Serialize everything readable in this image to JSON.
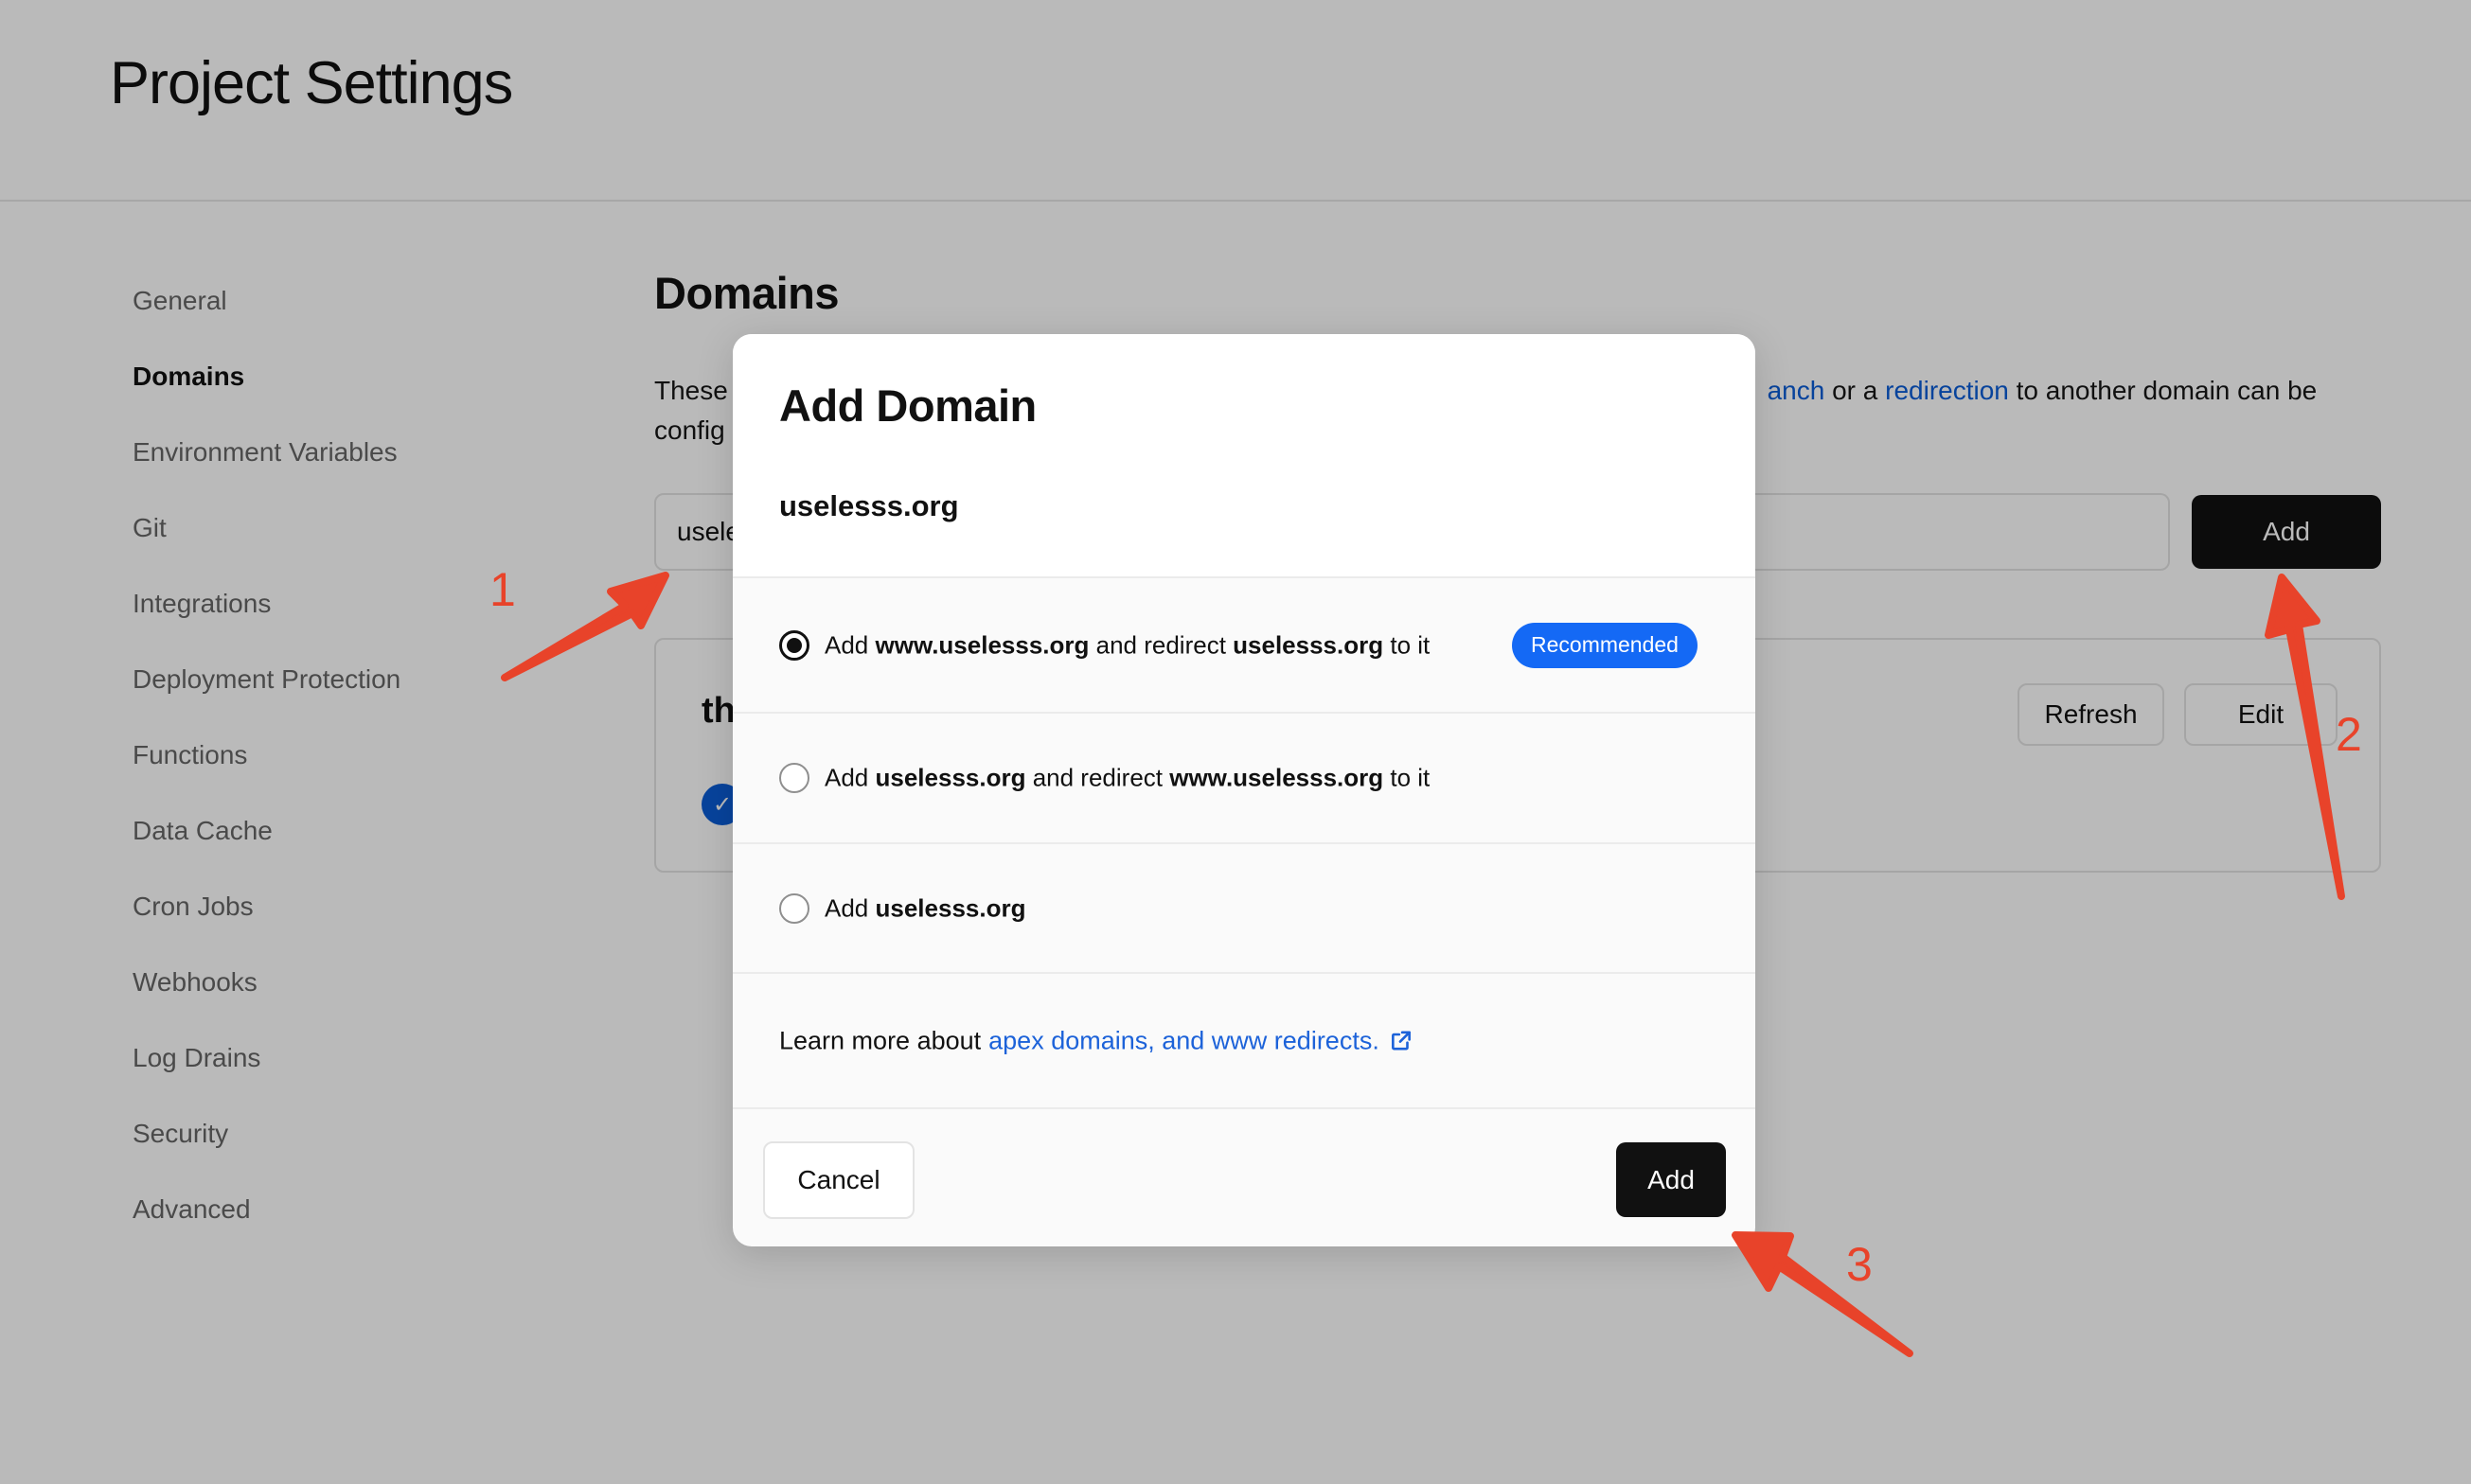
{
  "header": {
    "title": "Project Settings"
  },
  "sidebar": {
    "items": [
      {
        "label": "General",
        "active": false
      },
      {
        "label": "Domains",
        "active": true
      },
      {
        "label": "Environment Variables",
        "active": false
      },
      {
        "label": "Git",
        "active": false
      },
      {
        "label": "Integrations",
        "active": false
      },
      {
        "label": "Deployment Protection",
        "active": false
      },
      {
        "label": "Functions",
        "active": false
      },
      {
        "label": "Data Cache",
        "active": false
      },
      {
        "label": "Cron Jobs",
        "active": false
      },
      {
        "label": "Webhooks",
        "active": false
      },
      {
        "label": "Log Drains",
        "active": false
      },
      {
        "label": "Security",
        "active": false
      },
      {
        "label": "Advanced",
        "active": false
      }
    ]
  },
  "domains_section": {
    "title": "Domains",
    "description_start": "These",
    "description_link1": "anch",
    "description_mid": " or a ",
    "description_link2": "redirection",
    "description_end": " to another domain can be",
    "description_line2": "config",
    "input_value": "usele",
    "add_button": "Add",
    "card": {
      "title_partial": "th",
      "refresh_button": "Refresh",
      "edit_button": "Edit"
    }
  },
  "modal": {
    "title": "Add Domain",
    "domain": "uselesss.org",
    "options": [
      {
        "prefix": "Add ",
        "bold1": "www.uselesss.org",
        "mid": " and redirect ",
        "bold2": "uselesss.org",
        "suffix": " to it",
        "checked": true,
        "badge": "Recommended"
      },
      {
        "prefix": "Add ",
        "bold1": "uselesss.org",
        "mid": " and redirect ",
        "bold2": "www.uselesss.org",
        "suffix": " to it",
        "checked": false
      },
      {
        "prefix": "Add ",
        "bold1": "uselesss.org",
        "mid": "",
        "bold2": "",
        "suffix": "",
        "checked": false
      }
    ],
    "learn_more_text": "Learn more about",
    "learn_more_link": "apex domains, and www redirects.",
    "cancel_button": "Cancel",
    "add_button": "Add"
  },
  "annotations": {
    "color": "#e8432a",
    "labels": [
      "1",
      "2",
      "3"
    ]
  },
  "colors": {
    "accent_blue": "#1469f5",
    "link_blue": "#1c62d9",
    "button_dark": "#111111",
    "annotation_red": "#e8432a"
  }
}
